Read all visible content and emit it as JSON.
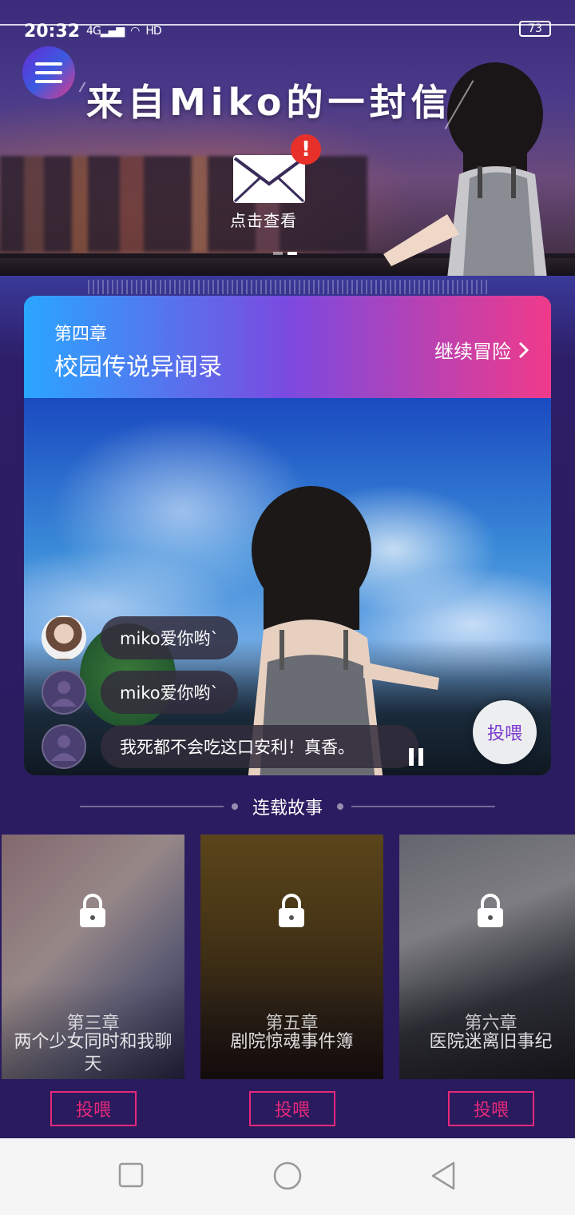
{
  "status_bar": {
    "time": "20:32",
    "signal_text": "4G",
    "hd_text": "HD",
    "battery": "73"
  },
  "banner": {
    "title": "来自Miko的一封信",
    "tap_to_view": "点击查看",
    "alert_mark": "!",
    "slide_count": 2,
    "active_slide": 2
  },
  "current_chapter": {
    "chapter_label": "第四章",
    "title": "校园传说异闻录",
    "continue_label": "继续冒险",
    "chat": [
      {
        "avatar": "photo-avatar",
        "text": "miko爱你哟`"
      },
      {
        "avatar": "default-avatar",
        "text": "miko爱你哟`"
      },
      {
        "avatar": "default-avatar",
        "text": "我死都不会吃这口安利！真香。"
      }
    ],
    "feed_label": "投喂"
  },
  "serialized": {
    "section_title": "连载故事",
    "stories": [
      {
        "chapter": "第三章",
        "title": "两个少女同时和我聊天",
        "locked": true,
        "feed_label": "投喂"
      },
      {
        "chapter": "第五章",
        "title": "剧院惊魂事件簿",
        "locked": true,
        "feed_label": "投喂"
      },
      {
        "chapter": "第六章",
        "title": "医院迷离旧事纪",
        "locked": true,
        "feed_label": "投喂"
      }
    ]
  },
  "colors": {
    "accent_pink": "#e8287a",
    "header_gradient_start": "#2aa6ff",
    "header_gradient_end": "#f03a8a",
    "background": "#2a1b5e",
    "alert_red": "#e8302a"
  },
  "icons": {
    "menu": "menu-icon",
    "envelope": "envelope-icon",
    "chevron": "chevron-right-icon",
    "lock": "lock-icon",
    "pause": "pause-icon",
    "nav_recent": "square-icon",
    "nav_home": "circle-icon",
    "nav_back": "triangle-back-icon"
  }
}
